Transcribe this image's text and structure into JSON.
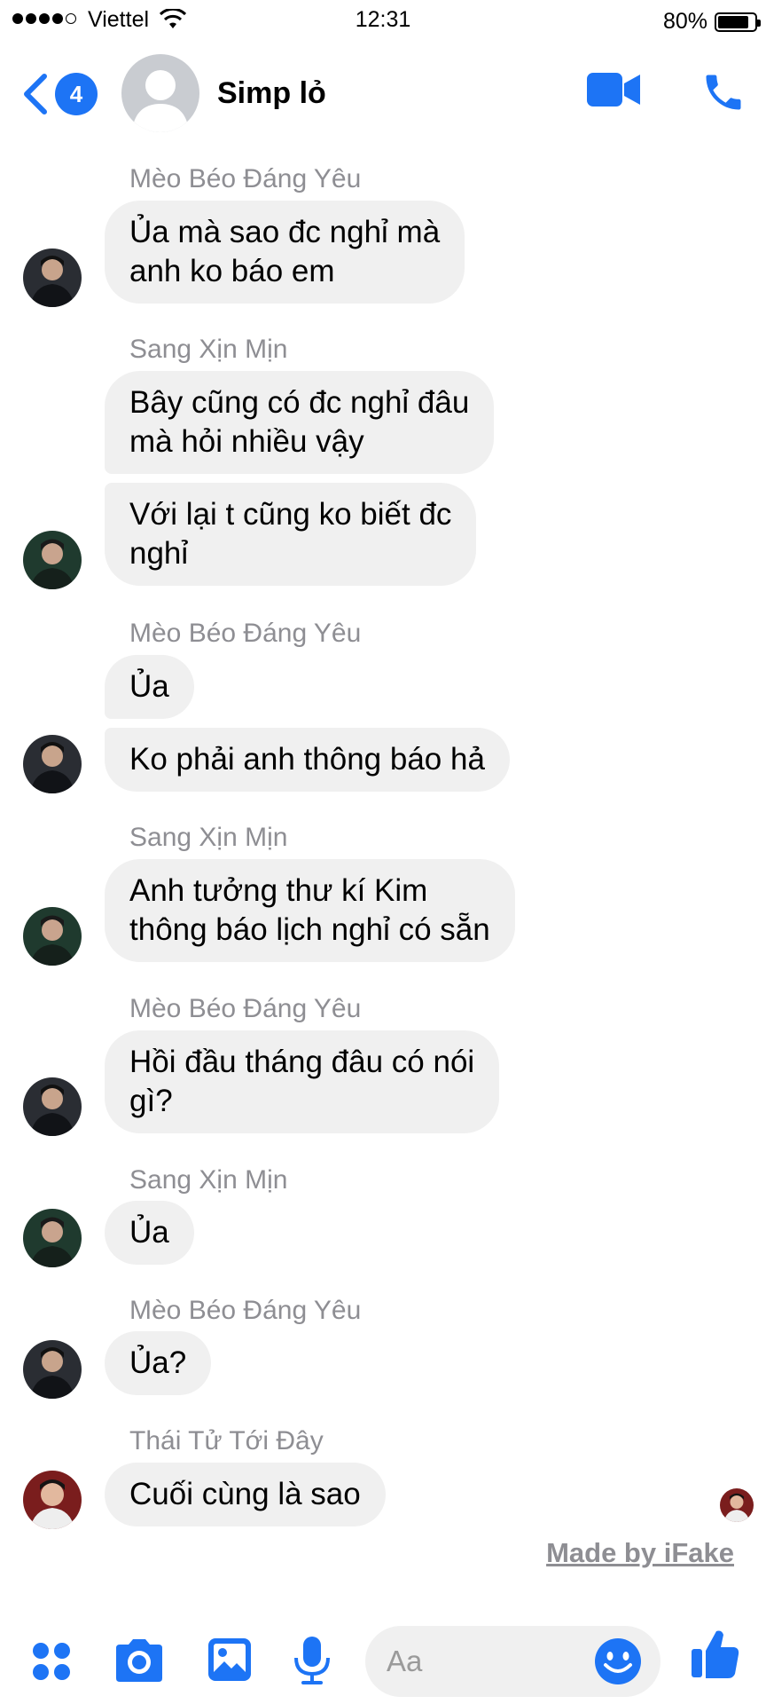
{
  "status_bar": {
    "carrier": "Viettel",
    "time": "12:31",
    "battery": "80%",
    "battery_level": 0.8
  },
  "header": {
    "unread_count": "4",
    "title": "Simp lỏ"
  },
  "messages": [
    {
      "sender": "Mèo Béo Đáng Yêu",
      "bubbles": [
        "Ủa mà sao đc nghỉ mà\nanh ko báo em"
      ]
    },
    {
      "sender": "Sang Xịn Mịn",
      "bubbles": [
        "Bây cũng có đc nghỉ đâu\nmà hỏi nhiều vậy",
        "Với lại t cũng ko biết đc\nnghỉ"
      ]
    },
    {
      "sender": "Mèo Béo Đáng Yêu",
      "bubbles": [
        "Ủa",
        "Ko phải anh thông báo hả"
      ]
    },
    {
      "sender": "Sang Xịn Mịn",
      "bubbles": [
        "Anh tưởng thư kí Kim\nthông báo lịch nghỉ có sẵn"
      ]
    },
    {
      "sender": "Mèo Béo Đáng Yêu",
      "bubbles": [
        "Hồi đầu tháng đâu có nói\ngì?"
      ]
    },
    {
      "sender": "Sang Xịn Mịn",
      "bubbles": [
        "Ủa"
      ]
    },
    {
      "sender": "Mèo Béo Đáng Yêu",
      "bubbles": [
        "Ủa?"
      ]
    },
    {
      "sender": "Thái Tử Tới Đây",
      "bubbles": [
        "Cuối cùng là sao"
      ]
    }
  ],
  "watermark": "Made by iFake",
  "composer": {
    "placeholder": "Aa"
  },
  "colors": {
    "accent": "#1d74f5",
    "bubble": "#f0f0f0",
    "sender_text": "#8e8e93"
  }
}
